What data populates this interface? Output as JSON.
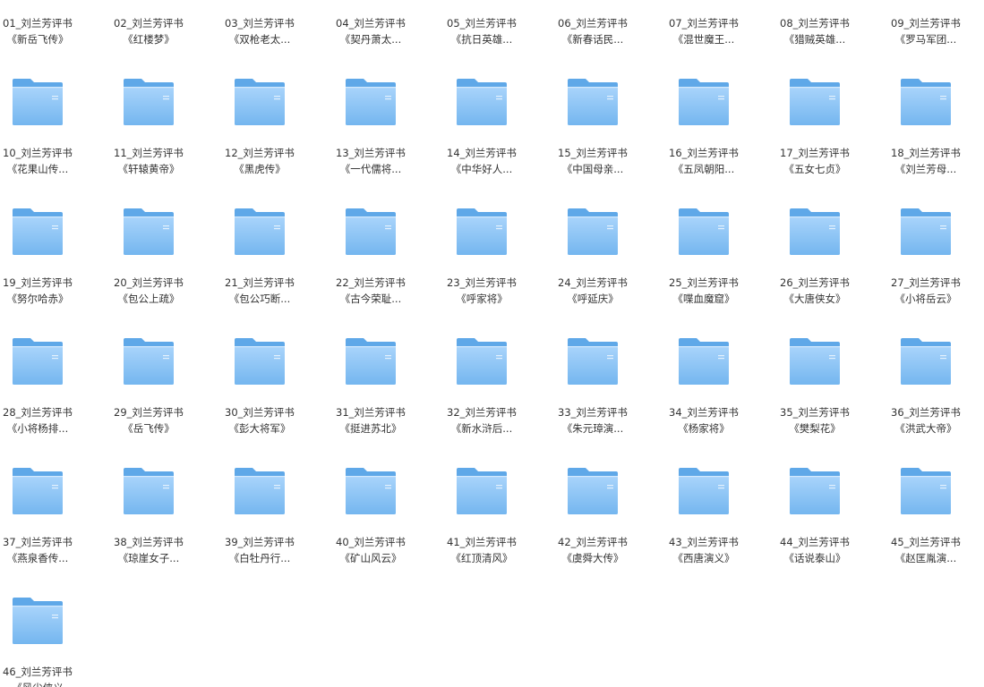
{
  "view": {
    "folders": [
      {
        "name": "01_刘兰芳评书",
        "subtitle": "《新岳飞传》"
      },
      {
        "name": "02_刘兰芳评书",
        "subtitle": "《红楼梦》"
      },
      {
        "name": "03_刘兰芳评书",
        "subtitle": "《双枪老太..."
      },
      {
        "name": "04_刘兰芳评书",
        "subtitle": "《契丹萧太..."
      },
      {
        "name": "05_刘兰芳评书",
        "subtitle": "《抗日英雄..."
      },
      {
        "name": "06_刘兰芳评书",
        "subtitle": "《新春话民..."
      },
      {
        "name": "07_刘兰芳评书",
        "subtitle": "《混世魔王..."
      },
      {
        "name": "08_刘兰芳评书",
        "subtitle": "《猎贼英雄..."
      },
      {
        "name": "09_刘兰芳评书",
        "subtitle": "《罗马军团..."
      },
      {
        "name": "10_刘兰芳评书",
        "subtitle": "《花果山传..."
      },
      {
        "name": "11_刘兰芳评书",
        "subtitle": "《轩辕黄帝》"
      },
      {
        "name": "12_刘兰芳评书",
        "subtitle": "《黑虎传》"
      },
      {
        "name": "13_刘兰芳评书",
        "subtitle": "《一代儒将..."
      },
      {
        "name": "14_刘兰芳评书",
        "subtitle": "《中华好人..."
      },
      {
        "name": "15_刘兰芳评书",
        "subtitle": "《中国母亲..."
      },
      {
        "name": "16_刘兰芳评书",
        "subtitle": "《五凤朝阳..."
      },
      {
        "name": "17_刘兰芳评书",
        "subtitle": "《五女七贞》"
      },
      {
        "name": "18_刘兰芳评书",
        "subtitle": "《刘兰芳母..."
      },
      {
        "name": "19_刘兰芳评书",
        "subtitle": "《努尔哈赤》"
      },
      {
        "name": "20_刘兰芳评书",
        "subtitle": "《包公上疏》"
      },
      {
        "name": "21_刘兰芳评书",
        "subtitle": "《包公巧断..."
      },
      {
        "name": "22_刘兰芳评书",
        "subtitle": "《古今荣耻..."
      },
      {
        "name": "23_刘兰芳评书",
        "subtitle": "《呼家将》"
      },
      {
        "name": "24_刘兰芳评书",
        "subtitle": "《呼延庆》"
      },
      {
        "name": "25_刘兰芳评书",
        "subtitle": "《喋血魔窟》"
      },
      {
        "name": "26_刘兰芳评书",
        "subtitle": "《大唐侠女》"
      },
      {
        "name": "27_刘兰芳评书",
        "subtitle": "《小将岳云》"
      },
      {
        "name": "28_刘兰芳评书",
        "subtitle": "《小将杨排..."
      },
      {
        "name": "29_刘兰芳评书",
        "subtitle": "《岳飞传》"
      },
      {
        "name": "30_刘兰芳评书",
        "subtitle": "《彭大将军》"
      },
      {
        "name": "31_刘兰芳评书",
        "subtitle": "《挺进苏北》"
      },
      {
        "name": "32_刘兰芳评书",
        "subtitle": "《新水浒后..."
      },
      {
        "name": "33_刘兰芳评书",
        "subtitle": "《朱元璋演..."
      },
      {
        "name": "34_刘兰芳评书",
        "subtitle": "《杨家将》"
      },
      {
        "name": "35_刘兰芳评书",
        "subtitle": "《樊梨花》"
      },
      {
        "name": "36_刘兰芳评书",
        "subtitle": "《洪武大帝》"
      },
      {
        "name": "37_刘兰芳评书",
        "subtitle": "《燕泉香传..."
      },
      {
        "name": "38_刘兰芳评书",
        "subtitle": "《琼崖女子..."
      },
      {
        "name": "39_刘兰芳评书",
        "subtitle": "《白牡丹行..."
      },
      {
        "name": "40_刘兰芳评书",
        "subtitle": "《矿山风云》"
      },
      {
        "name": "41_刘兰芳评书",
        "subtitle": "《红顶清风》"
      },
      {
        "name": "42_刘兰芳评书",
        "subtitle": "《虞舜大传》"
      },
      {
        "name": "43_刘兰芳评书",
        "subtitle": "《西唐演义》"
      },
      {
        "name": "44_刘兰芳评书",
        "subtitle": "《话说泰山》"
      },
      {
        "name": "45_刘兰芳评书",
        "subtitle": "《赵匡胤演..."
      },
      {
        "name": "46_刘兰芳评书",
        "subtitle": "《风尘侠义"
      }
    ]
  },
  "colors": {
    "folder_back": "#5fa8e8",
    "folder_front_top": "#a9d4fb",
    "folder_front_bottom": "#74b6ef",
    "label_text": "#333333"
  },
  "icon": "folder-icon"
}
